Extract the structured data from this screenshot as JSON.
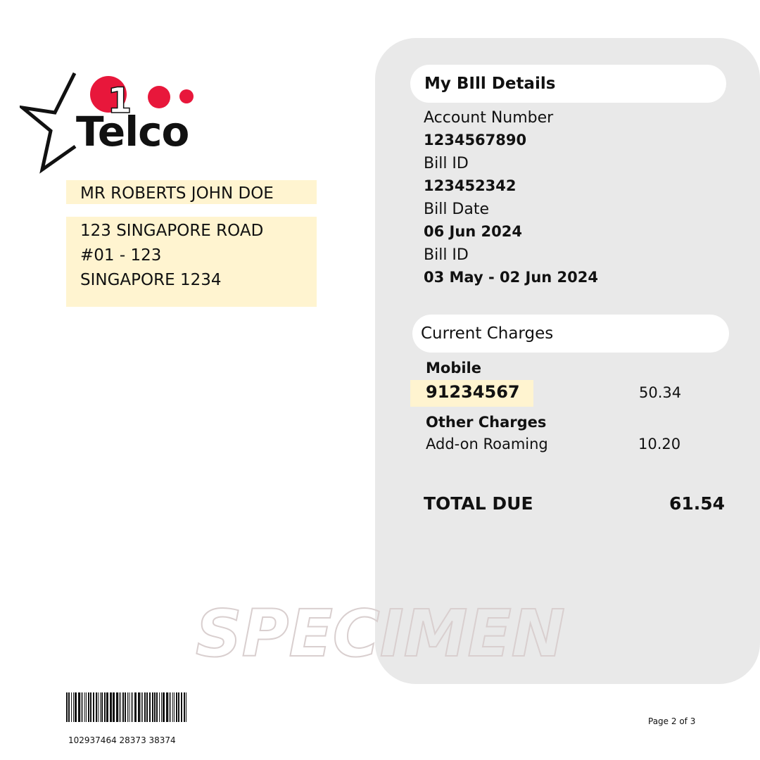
{
  "brand": {
    "logo_digit": "1",
    "logo_word": "Telco",
    "accent_color": "#e8173b"
  },
  "customer": {
    "name": "MR ROBERTS JOHN DOE",
    "address_lines": [
      "123 SINGAPORE ROAD",
      "#01 - 123",
      "SINGAPORE 1234"
    ]
  },
  "bill_details": {
    "title": "My  BIll Details",
    "fields": [
      {
        "label": "Account Number",
        "value": "1234567890"
      },
      {
        "label": "Bill ID",
        "value": "123452342"
      },
      {
        "label": "Bill Date",
        "value": "06 Jun 2024"
      },
      {
        "label": "Bill ID",
        "value": "03 May - 02 Jun 2024"
      }
    ]
  },
  "current_charges": {
    "title": "Current Charges",
    "mobile_heading": "Mobile",
    "mobile_number": "91234567",
    "mobile_amount": "50.34",
    "other_heading": "Other Charges",
    "other_item": "Add-on Roaming",
    "other_amount": "10.20",
    "total_label": "TOTAL DUE",
    "total_amount": "61.54"
  },
  "watermark": "SPECIMEN",
  "barcode_number": "102937464 28373 38374",
  "page_label": "Page 2 of 3",
  "colors": {
    "highlight": "#fff4d0",
    "panel": "#e9e9e9"
  }
}
